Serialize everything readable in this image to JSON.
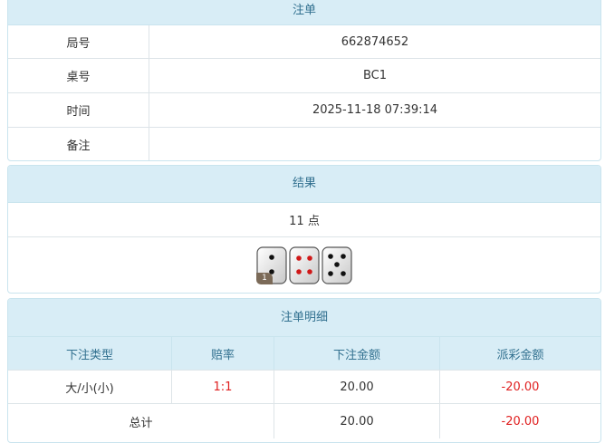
{
  "order": {
    "title": "注单",
    "rows": [
      {
        "label": "局号",
        "value": "662874652"
      },
      {
        "label": "桌号",
        "value": "BC1"
      },
      {
        "label": "时间",
        "value": "2025-11-18 07:39:14"
      },
      {
        "label": "备注",
        "value": ""
      }
    ]
  },
  "result": {
    "title": "结果",
    "points_text": "11 点",
    "dice": [
      {
        "value": 2,
        "pip_color": "#111111",
        "badge": "1"
      },
      {
        "value": 4,
        "pip_color": "#d01818"
      },
      {
        "value": 5,
        "pip_color": "#111111"
      }
    ]
  },
  "details": {
    "title": "注单明细",
    "headers": [
      "下注类型",
      "赔率",
      "下注金额",
      "派彩金额"
    ],
    "rows": [
      {
        "type": "大/小(小)",
        "odds": "1:1",
        "bet": "20.00",
        "payout": "-20.00"
      }
    ],
    "total": {
      "label": "总计",
      "bet": "20.00",
      "payout": "-20.00"
    }
  },
  "colors": {
    "header_bg": "#d8edf6",
    "header_text": "#31708f",
    "negative": "#e02020",
    "odds": "#e02020"
  }
}
